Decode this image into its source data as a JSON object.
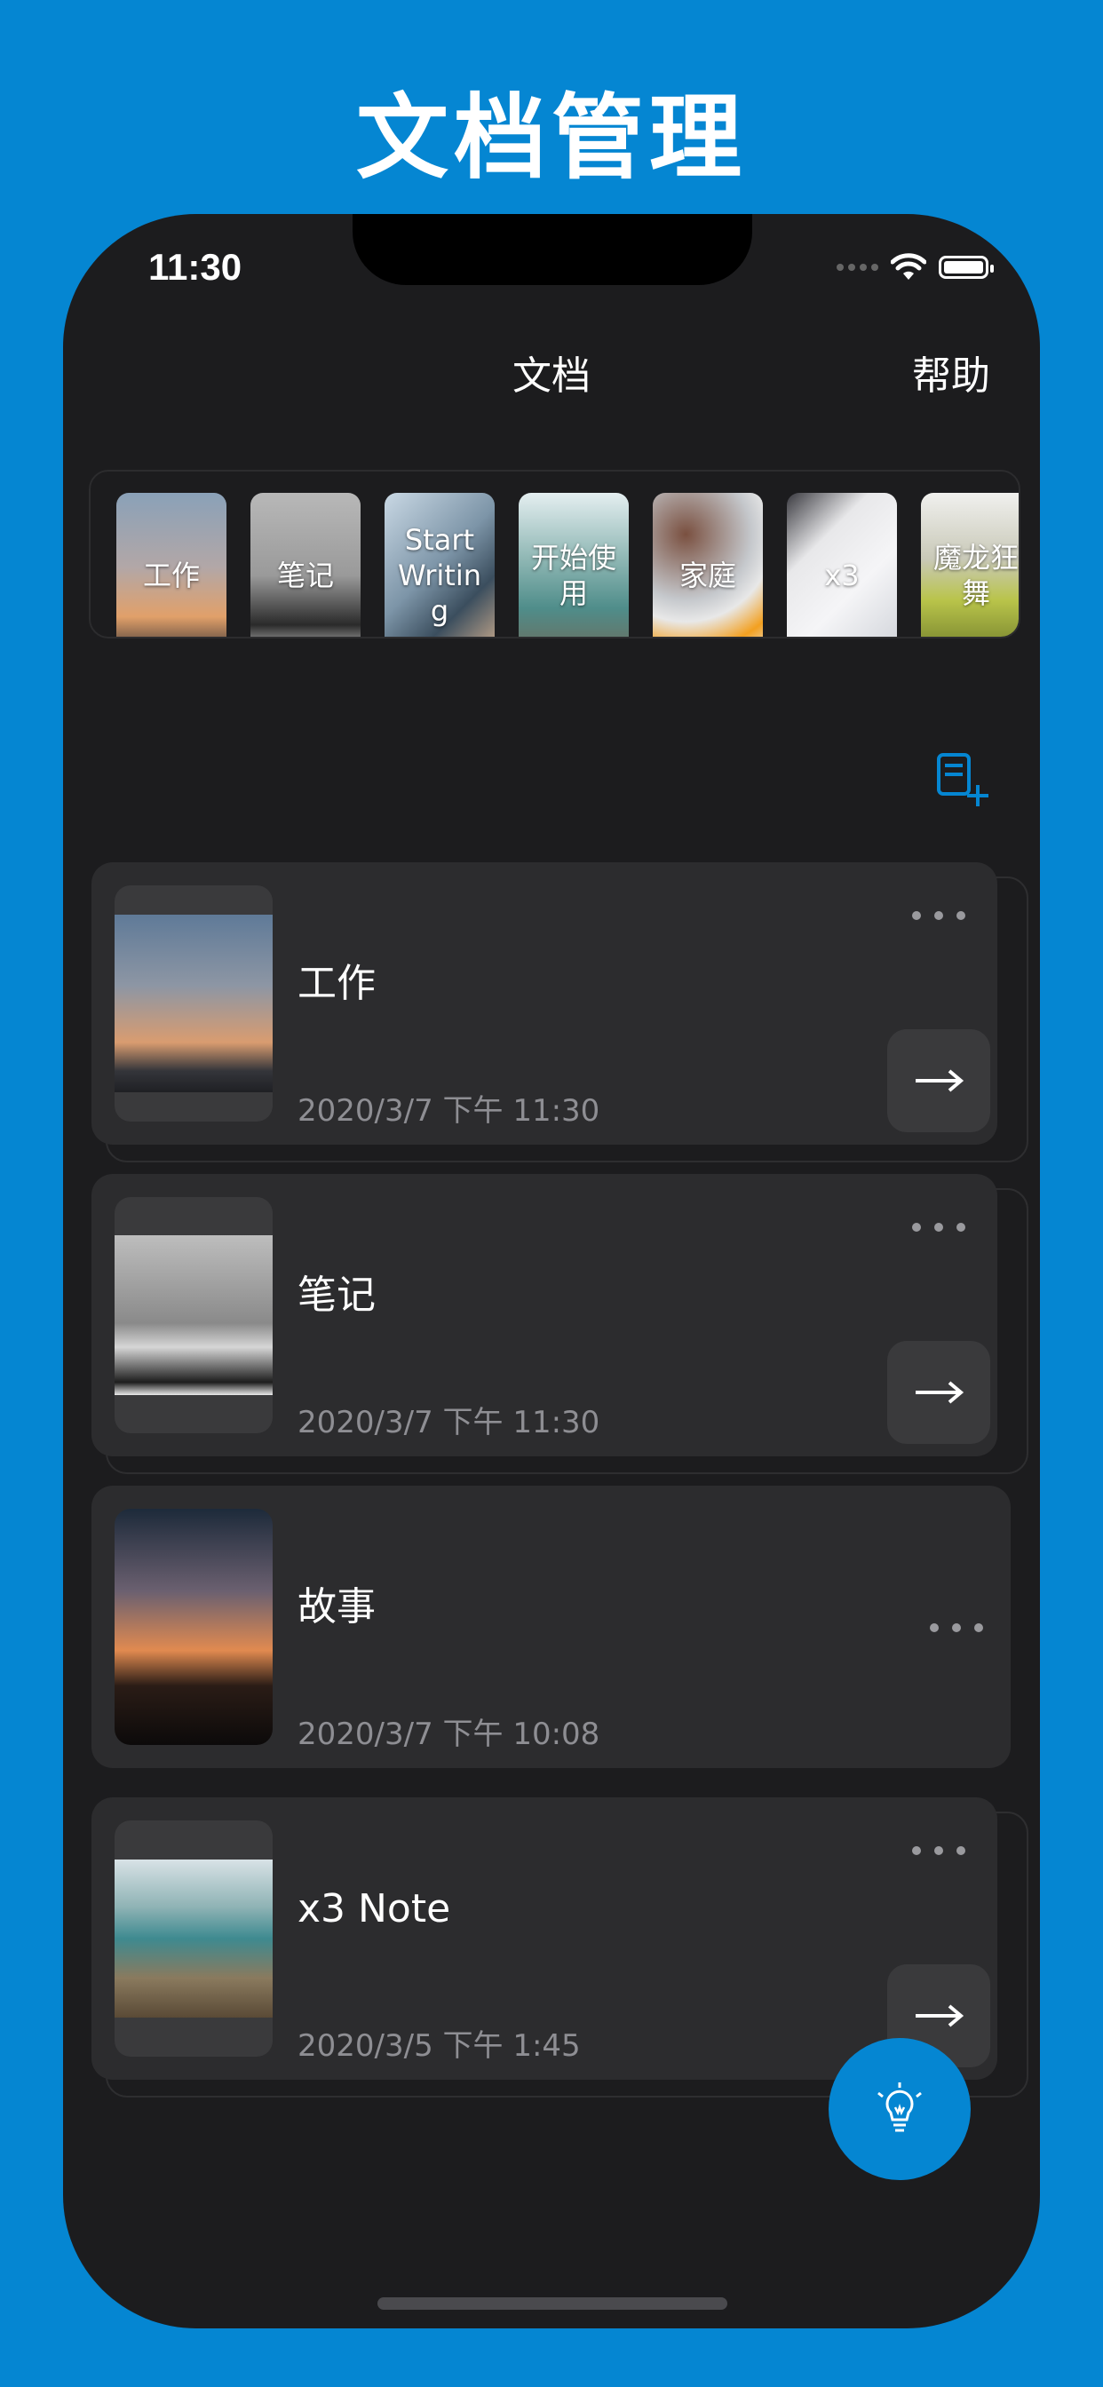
{
  "headline": "文档管理",
  "status": {
    "time": "11:30"
  },
  "nav": {
    "title": "文档",
    "help": "帮助"
  },
  "notebooks": [
    {
      "label": "工作"
    },
    {
      "label": "笔记"
    },
    {
      "label": "Start Writing"
    },
    {
      "label": "开始使用"
    },
    {
      "label": "家庭"
    },
    {
      "label": "x3"
    },
    {
      "label": "魔龙狂舞"
    }
  ],
  "documents": [
    {
      "title": "工作",
      "date": "2020/3/7 下午 11:30"
    },
    {
      "title": "笔记",
      "date": "2020/3/7 下午 11:30"
    },
    {
      "title": "故事",
      "date": "2020/3/7 下午 10:08"
    },
    {
      "title": "x3 Note",
      "date": "2020/3/5 下午 1:45"
    }
  ],
  "icons": {
    "add_document": "add-document-icon",
    "more": "more-icon",
    "arrow": "arrow-right-icon",
    "fab": "lightbulb-icon"
  },
  "colors": {
    "accent": "#0586d2",
    "background": "#1c1c1e",
    "card": "#2c2c2e"
  }
}
